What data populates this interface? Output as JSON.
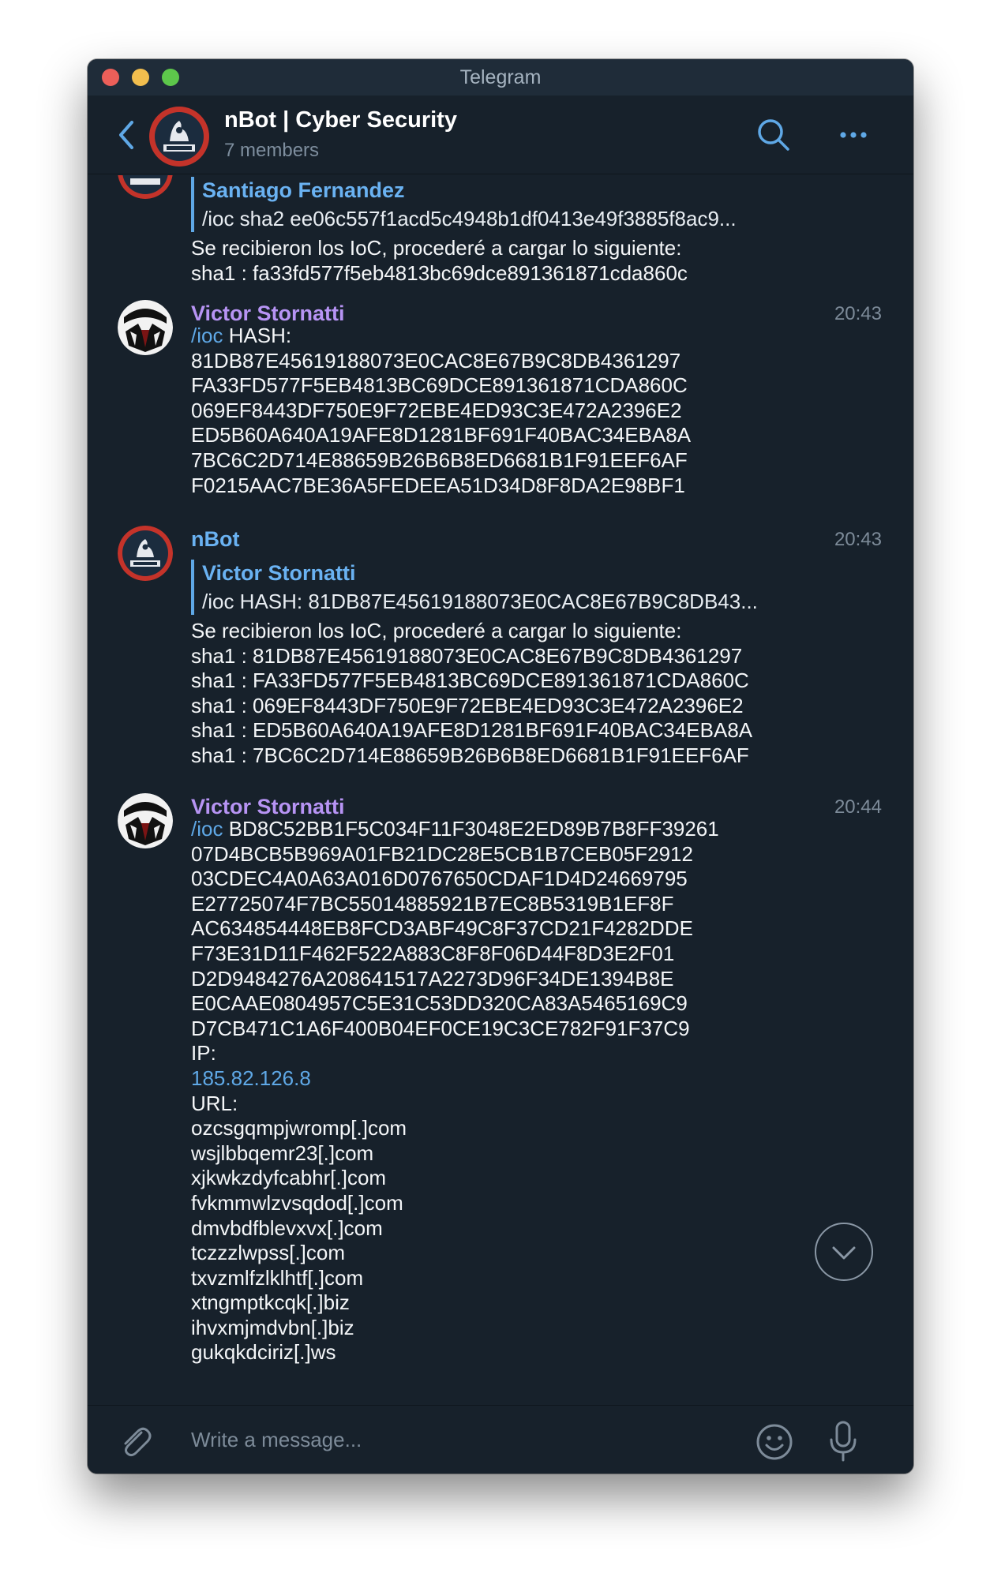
{
  "window": {
    "title": "Telegram"
  },
  "header": {
    "chat_name": "nBot | Cyber Security",
    "members": "7 members"
  },
  "messages": [
    {
      "reply": {
        "name": "Santiago Fernandez",
        "text": "/ioc sha2 ee06c557f1acd5c4948b1df0413e49f3885f8ac9..."
      },
      "lines": [
        "Se recibieron los IoC, procederé a cargar lo siguiente:",
        "sha1 : fa33fd577f5eb4813bc69dce891361871cda860c"
      ]
    },
    {
      "sender": "Victor Stornatti",
      "time": "20:43",
      "command": "/ioc",
      "first_line_rest": " HASH:",
      "lines": [
        "81DB87E45619188073E0CAC8E67B9C8DB4361297",
        "FA33FD577F5EB4813BC69DCE891361871CDA860C",
        "069EF8443DF750E9F72EBE4ED93C3E472A2396E2",
        "ED5B60A640A19AFE8D1281BF691F40BAC34EBA8A",
        "7BC6C2D714E88659B26B6B8ED6681B1F91EEF6AF",
        "F0215AAC7BE36A5FEDEEA51D34D8F8DA2E98BF1"
      ]
    },
    {
      "sender": "nBot",
      "time": "20:43",
      "reply": {
        "name": "Victor Stornatti",
        "text": "/ioc HASH:   81DB87E45619188073E0CAC8E67B9C8DB43..."
      },
      "lines": [
        "Se recibieron los IoC, procederé a cargar lo siguiente:",
        "sha1 : 81DB87E45619188073E0CAC8E67B9C8DB4361297",
        "sha1 : FA33FD577F5EB4813BC69DCE891361871CDA860C",
        "sha1 : 069EF8443DF750E9F72EBE4ED93C3E472A2396E2",
        "sha1 : ED5B60A640A19AFE8D1281BF691F40BAC34EBA8A",
        "sha1 : 7BC6C2D714E88659B26B6B8ED6681B1F91EEF6AF"
      ]
    },
    {
      "sender": "Victor Stornatti",
      "time": "20:44",
      "command": "/ioc",
      "first_line_rest": " BD8C52BB1F5C034F11F3048E2ED89B7B8FF39261",
      "lines": [
        "07D4BCB5B969A01FB21DC28E5CB1B7CEB05F2912",
        "03CDEC4A0A63A016D0767650CDAF1D4D24669795",
        "E27725074F7BC55014885921B7EC8B5319B1EF8F",
        "AC634854448EB8FCD3ABF49C8F37CD21F4282DDE",
        "F73E31D11F462F522A883C8F8F06D44F8D3E2F01",
        "D2D9484276A208641517A2273D96F34DE1394B8E",
        "E0CAAE0804957C5E31C53DD320CA83A5465169C9",
        "D7CB471C1A6F400B04EF0CE19C3CE782F91F37C9",
        "IP:"
      ],
      "ip_link": "185.82.126.8",
      "url_label": "URL:",
      "urls": [
        "ozcsgqmpjwromp[.]com",
        "wsjlbbqemr23[.]com",
        "xjkwkzdyfcabhr[.]com",
        "fvkmmwlzvsqdod[.]com",
        "dmvbdfblevxvx[.]com",
        "tczzzlwpss[.]com",
        "txvzmlfzlklhtf[.]com",
        "xtngmptkcqk[.]biz",
        "ihvxmjmdvbn[.]biz",
        "gukqkdciriz[.]ws"
      ]
    }
  ],
  "composer": {
    "placeholder": "Write a message..."
  },
  "colors": {
    "background": "#17212b",
    "accent": "#5fa8e6",
    "sender_victor": "#b794f4",
    "sender_nbot": "#6ab2f2",
    "text": "#f4f6f8",
    "muted": "#7d8b99"
  },
  "icons": {
    "back": "chevron-left-icon",
    "search": "search-icon",
    "more": "more-horizontal-icon",
    "attach": "paperclip-icon",
    "emoji": "smiley-icon",
    "mic": "microphone-icon",
    "scroll_down": "chevron-down-icon"
  }
}
